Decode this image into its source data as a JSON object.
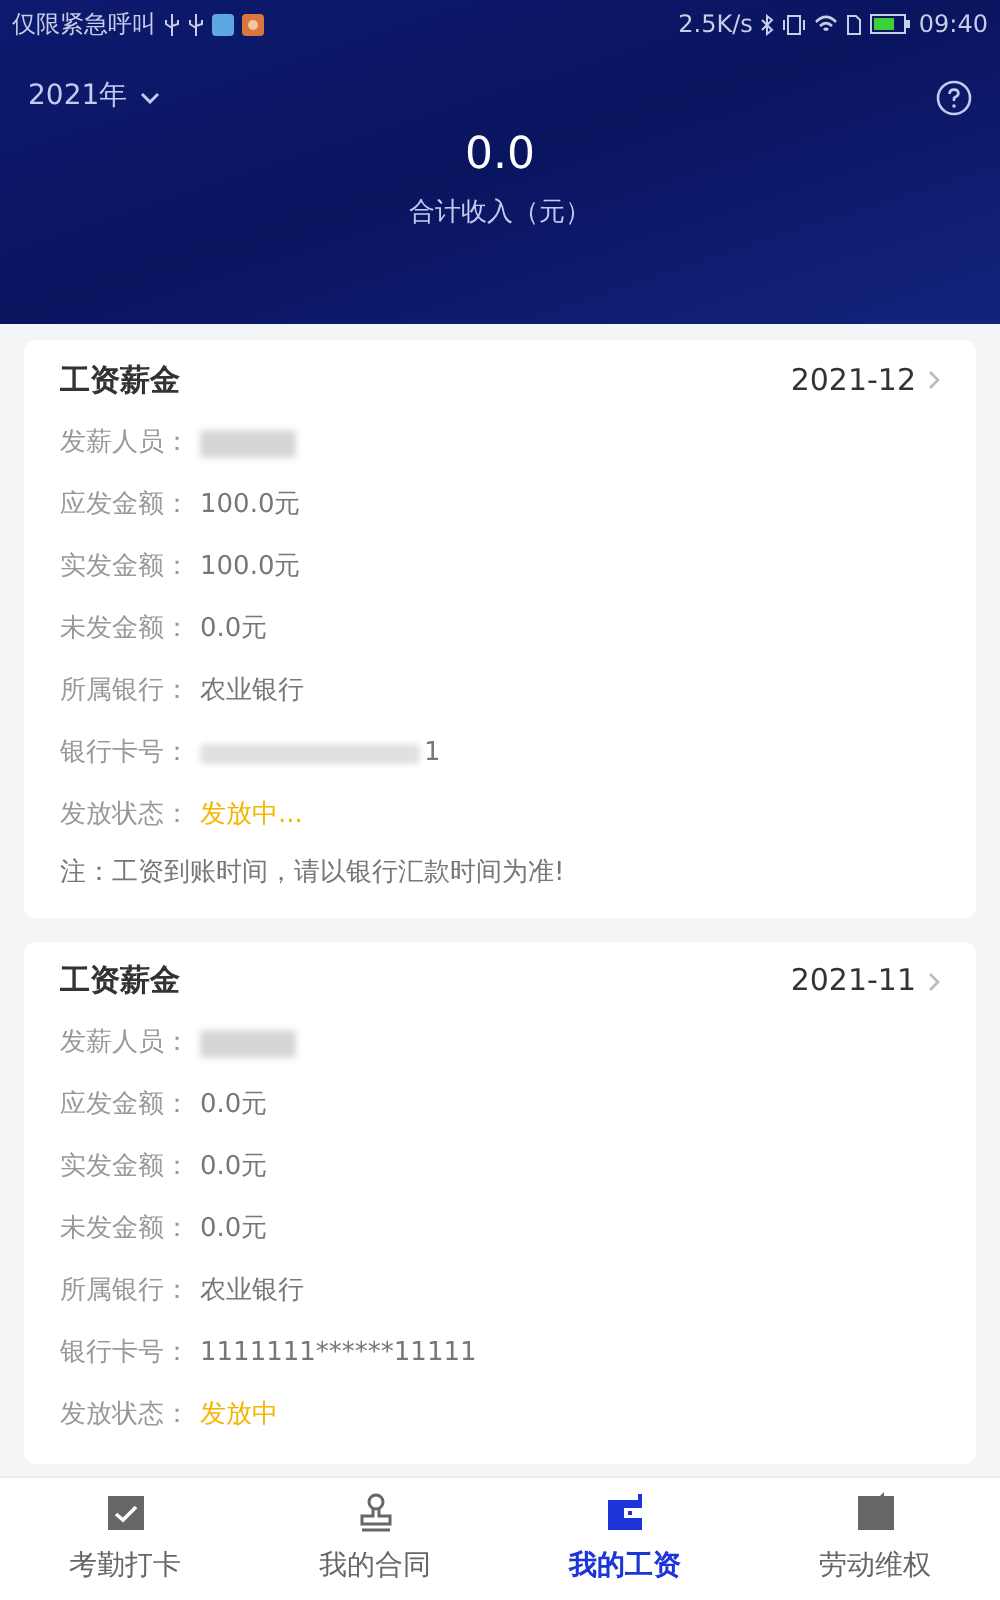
{
  "status_bar": {
    "carrier": "仅限紧急呼叫",
    "speed": "2.5K/s",
    "time": "09:40"
  },
  "header": {
    "year": "2021年",
    "total": "0.0",
    "total_label": "合计收入（元）"
  },
  "cards": [
    {
      "title": "工资薪金",
      "month": "2021-12",
      "fields": [
        {
          "kind": "redacted",
          "label": "发薪人员："
        },
        {
          "kind": "text",
          "label": "应发金额：",
          "value": "100.0元"
        },
        {
          "kind": "text",
          "label": "实发金额：",
          "value": "100.0元"
        },
        {
          "kind": "text",
          "label": "未发金额：",
          "value": "0.0元"
        },
        {
          "kind": "text",
          "label": "所属银行：",
          "value": "农业银行"
        },
        {
          "kind": "redacted",
          "label": "银行卡号：",
          "value": "1"
        },
        {
          "kind": "status",
          "label": "发放状态：",
          "value": "发放中..."
        }
      ],
      "note": "注：工资到账时间，请以银行汇款时间为准!"
    },
    {
      "title": "工资薪金",
      "month": "2021-11",
      "fields": [
        {
          "kind": "redacted",
          "label": "发薪人员："
        },
        {
          "kind": "text",
          "label": "应发金额：",
          "value": "0.0元"
        },
        {
          "kind": "text",
          "label": "实发金额：",
          "value": "0.0元"
        },
        {
          "kind": "text",
          "label": "未发金额：",
          "value": "0.0元"
        },
        {
          "kind": "text",
          "label": "所属银行：",
          "value": "农业银行"
        },
        {
          "kind": "text",
          "label": "银行卡号：",
          "value": "1111111******11111"
        },
        {
          "kind": "status",
          "label": "发放状态：",
          "value": "发放中"
        }
      ]
    }
  ],
  "tabs": [
    {
      "label": "考勤打卡",
      "selected": false
    },
    {
      "label": "我的合同",
      "selected": false
    },
    {
      "label": "我的工资",
      "selected": true
    },
    {
      "label": "劳动维权",
      "selected": false
    }
  ]
}
